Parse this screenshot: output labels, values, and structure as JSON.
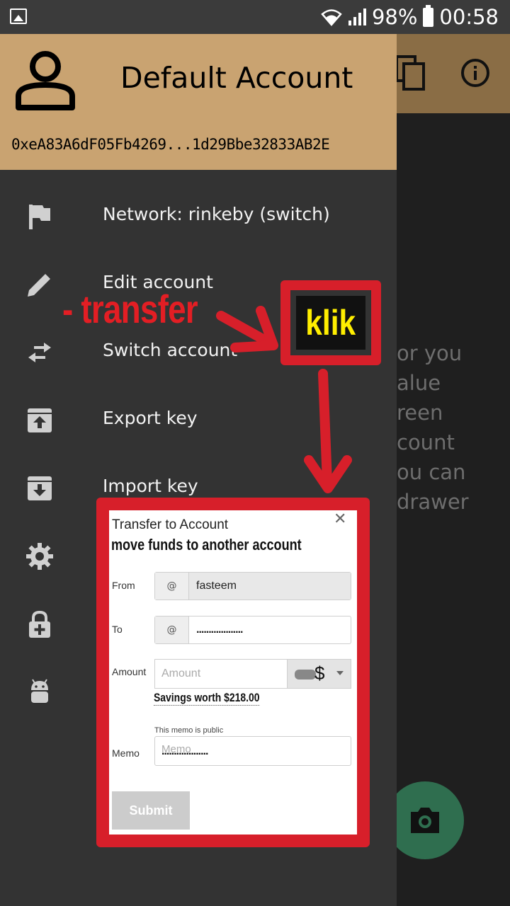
{
  "status_bar": {
    "battery": "98%",
    "time": "00:58"
  },
  "drawer": {
    "account_title": "Default Account",
    "account_address": "0xeA83A6dF05Fb4269...1d29Bbe32833AB2E",
    "menu": [
      {
        "label": "Network: rinkeby (switch)",
        "icon": "flag-icon"
      },
      {
        "label": "Edit account",
        "icon": "pencil-icon"
      },
      {
        "label": "Switch account",
        "icon": "swap-icon"
      },
      {
        "label": "Export key",
        "icon": "export-icon"
      },
      {
        "label": "Import key",
        "icon": "import-icon"
      },
      {
        "label": "",
        "icon": "gear-icon"
      },
      {
        "label": "",
        "icon": "lock-plus-icon"
      },
      {
        "label": "",
        "icon": "android-icon"
      }
    ]
  },
  "background_text": "or you\nalue\nreen\ncount\nou can\ndrawer",
  "annotations": {
    "transfer": "- transfer",
    "klik": "klik",
    "color": "#d71f2a"
  },
  "dialog": {
    "title": "Transfer to Account",
    "subtitle": "move funds to another account",
    "from_label": "From",
    "from_prefix": "@",
    "from_value": "fasteem",
    "to_label": "To",
    "to_prefix": "@",
    "to_value": "...................",
    "amount_label": "Amount",
    "amount_placeholder": "Amount",
    "currency_symbol": "$",
    "savings_text": "Savings worth $218.00",
    "memo_note": "This memo is public",
    "memo_label": "Memo",
    "memo_placeholder": "Memo",
    "memo_value": "...................",
    "submit_label": "Submit"
  }
}
